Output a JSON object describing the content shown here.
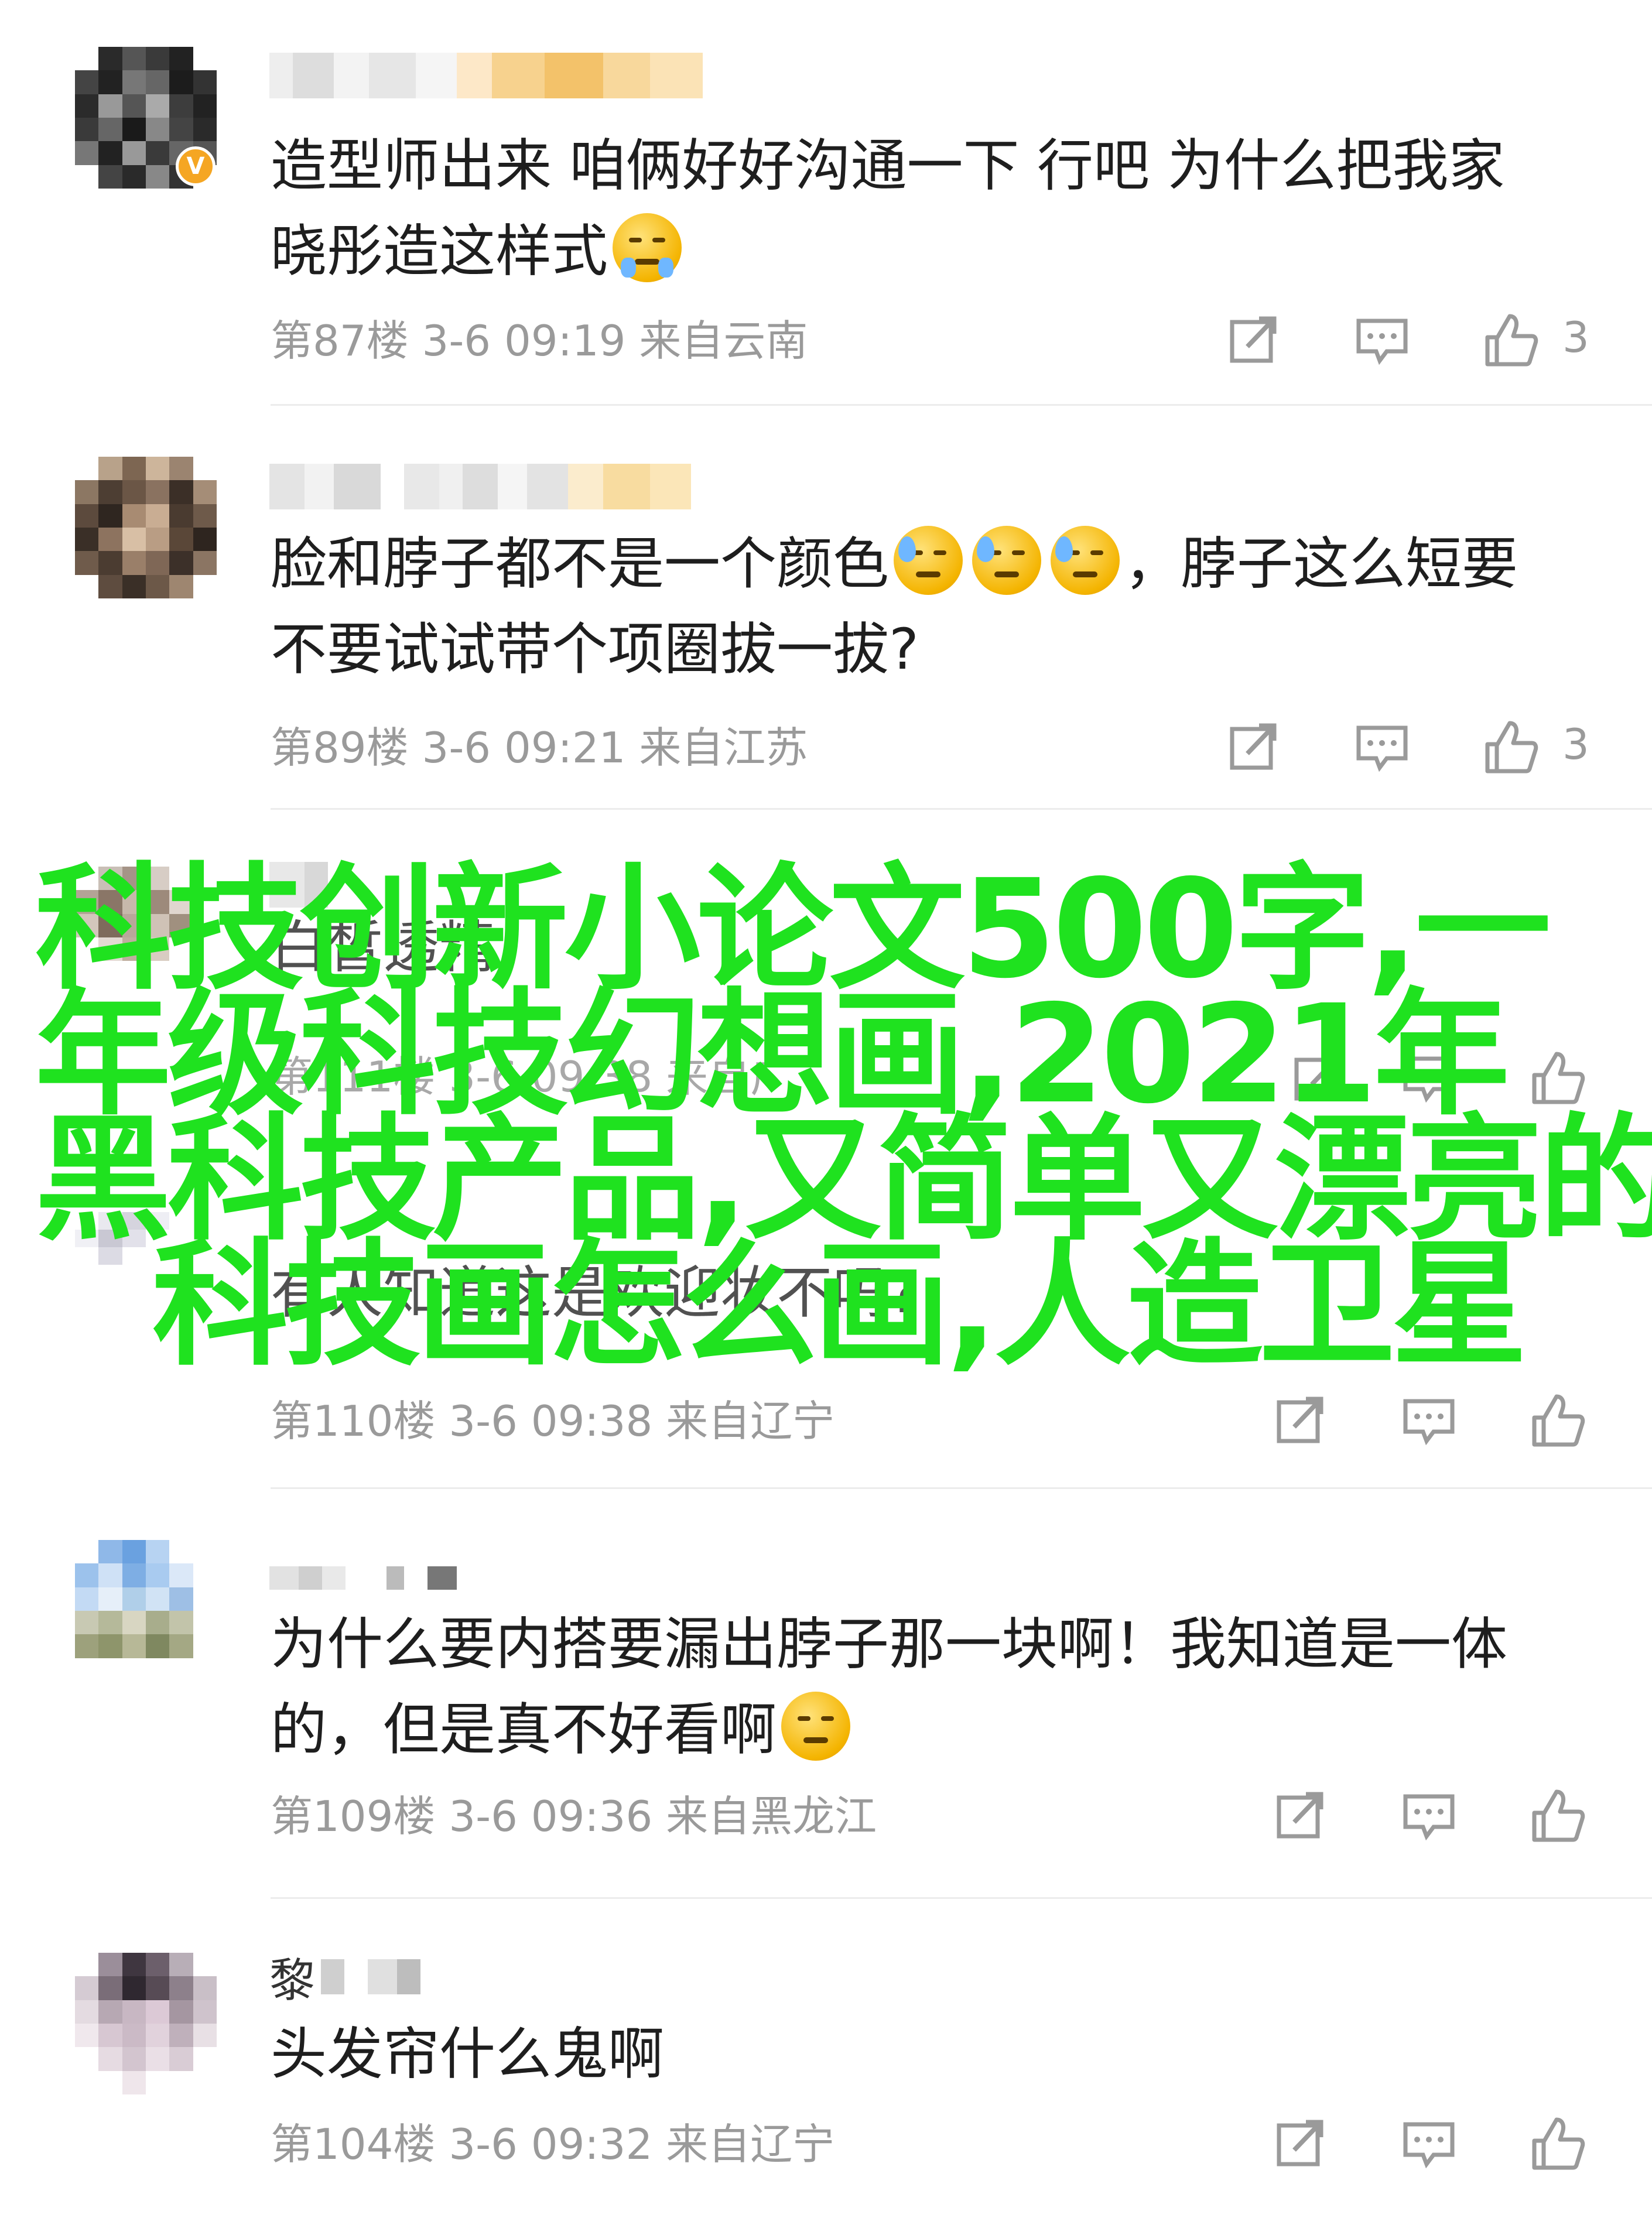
{
  "comments": [
    {
      "text": "造型师出来 咱俩好好沟通一下 行吧 为什么把我家晓彤造这样式",
      "line1": "造型师出来 咱俩好好沟通一下 行吧 为什么把我家",
      "line2": "晓彤造这样式",
      "meta": "第87楼 3-6 09:19 来自云南",
      "likes": "3",
      "verified_badge": "V"
    },
    {
      "line1a": "脸和脖子都不是一个颜色",
      "line1b": "，脖子这么短要",
      "line2": "不要试试带个项圈拔一拔?",
      "meta": "第89楼 3-6 09:21 来自江苏",
      "likes": "3"
    },
    {
      "nick_char": "白",
      "ghost_line": "白皙透精",
      "meta_hidden": "第111楼 3-6 09:38 来自广",
      "likes": ""
    },
    {
      "line1": "有人知道这是欢迎妆不吗?",
      "meta": "第110楼 3-6 09:38 来自辽宁",
      "likes": ""
    },
    {
      "line1": "为什么要内搭要漏出脖子那一块啊！我知道是一体",
      "line2": "的，但是真不好看啊",
      "meta": "第109楼 3-6 09:36 来自黑龙江",
      "likes": ""
    },
    {
      "nick_char": "黎",
      "line1": "头发帘什么鬼啊",
      "meta": "第104楼 3-6 09:32 来自辽宁",
      "likes": ""
    }
  ],
  "overlay": {
    "line1": "科技创新小论文500字,一",
    "line2": "年级科技幻想画,2021年",
    "line3": "黑科技产品,又简单又漂亮的",
    "line4": "科技画怎么画,人造卫星"
  },
  "icons": {
    "share": "share-edit-icon",
    "comment": "comment-bubble-icon",
    "like": "thumbs-up-icon"
  },
  "colors": {
    "overlay_text": "#1fe21f",
    "meta_text": "#9a9a9a",
    "body_text": "#1e1e1e",
    "badge": "#f5a623"
  }
}
